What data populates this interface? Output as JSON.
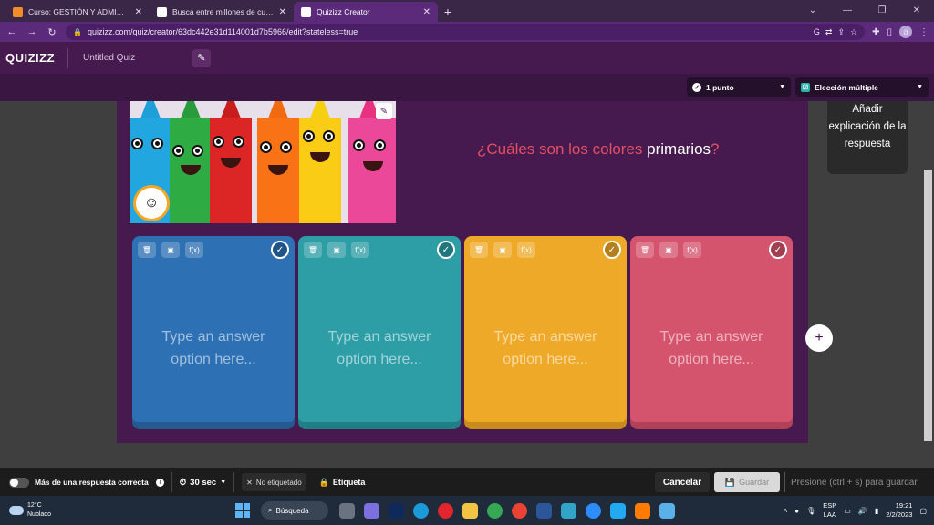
{
  "browser": {
    "tabs": [
      {
        "title": "Curso: GESTIÓN Y ADMINISTRAC",
        "fav_color": "#f28c28",
        "active": false
      },
      {
        "title": "Busca entre millones de cuestion",
        "fav_color": "#ffffff",
        "active": false
      },
      {
        "title": "Quizizz Creator",
        "fav_color": "#ffffff",
        "active": true
      }
    ],
    "url": "quizizz.com/quiz/creator/63dc442e31d114001d7b5966/edit?stateless=true",
    "profile_letter": "a"
  },
  "header": {
    "logo": "QUIZIZZ",
    "quiz_title": "Untitled Quiz"
  },
  "toolbar": {
    "points_label": "1 punto",
    "type_label": "Elección múltiple"
  },
  "question": {
    "text_before": "¿Cuáles son los colores ",
    "text_highlight": "primarios",
    "text_after": "?"
  },
  "explanation_button": "Añadir explicación de la respuesta",
  "answers": [
    {
      "placeholder": "Type an answer option here...",
      "color": "#2d70b3",
      "shadow": "#245a91"
    },
    {
      "placeholder": "Type an answer option here...",
      "color": "#2d9da6",
      "shadow": "#227e86"
    },
    {
      "placeholder": "Type an answer option here...",
      "color": "#efa929",
      "shadow": "#c98b1a"
    },
    {
      "placeholder": "Type an answer option here...",
      "color": "#d5546d",
      "shadow": "#b04158"
    }
  ],
  "bottom": {
    "multi_correct_label": "Más de una respuesta correcta",
    "timer_label": "30 sec",
    "untagged_label": "No etiquetado",
    "tag_label": "Etiqueta",
    "cancel_label": "Cancelar",
    "save_label": "Guardar",
    "hint": "Presione (ctrl + s) para guardar"
  },
  "taskbar": {
    "temp": "12°C",
    "weather": "Nublado",
    "search_label": "Búsqueda",
    "lang_1": "ESP",
    "lang_2": "LAA",
    "time": "19:21",
    "date": "2/2/2023"
  }
}
